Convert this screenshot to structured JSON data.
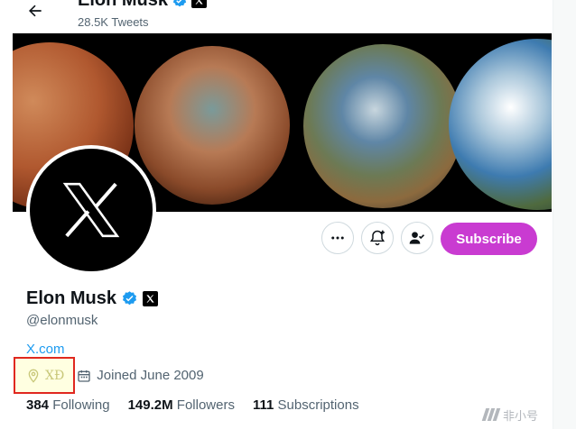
{
  "header": {
    "name": "Elon Musk",
    "tweet_count": "28.5K Tweets"
  },
  "profile": {
    "name": "Elon Musk",
    "handle": "@elonmusk",
    "website": "X.com",
    "location": "XĐ",
    "joined": "Joined June 2009",
    "following_count": "384",
    "following_label": "Following",
    "followers_count": "149.2M",
    "followers_label": "Followers",
    "subscriptions_count": "111",
    "subscriptions_label": "Subscriptions"
  },
  "actions": {
    "subscribe_label": "Subscribe"
  },
  "watermark": {
    "text": "非小号"
  },
  "colors": {
    "accent": "#1d9bf0",
    "subscribe": "#c93bd1",
    "highlight": "#e0281f"
  }
}
